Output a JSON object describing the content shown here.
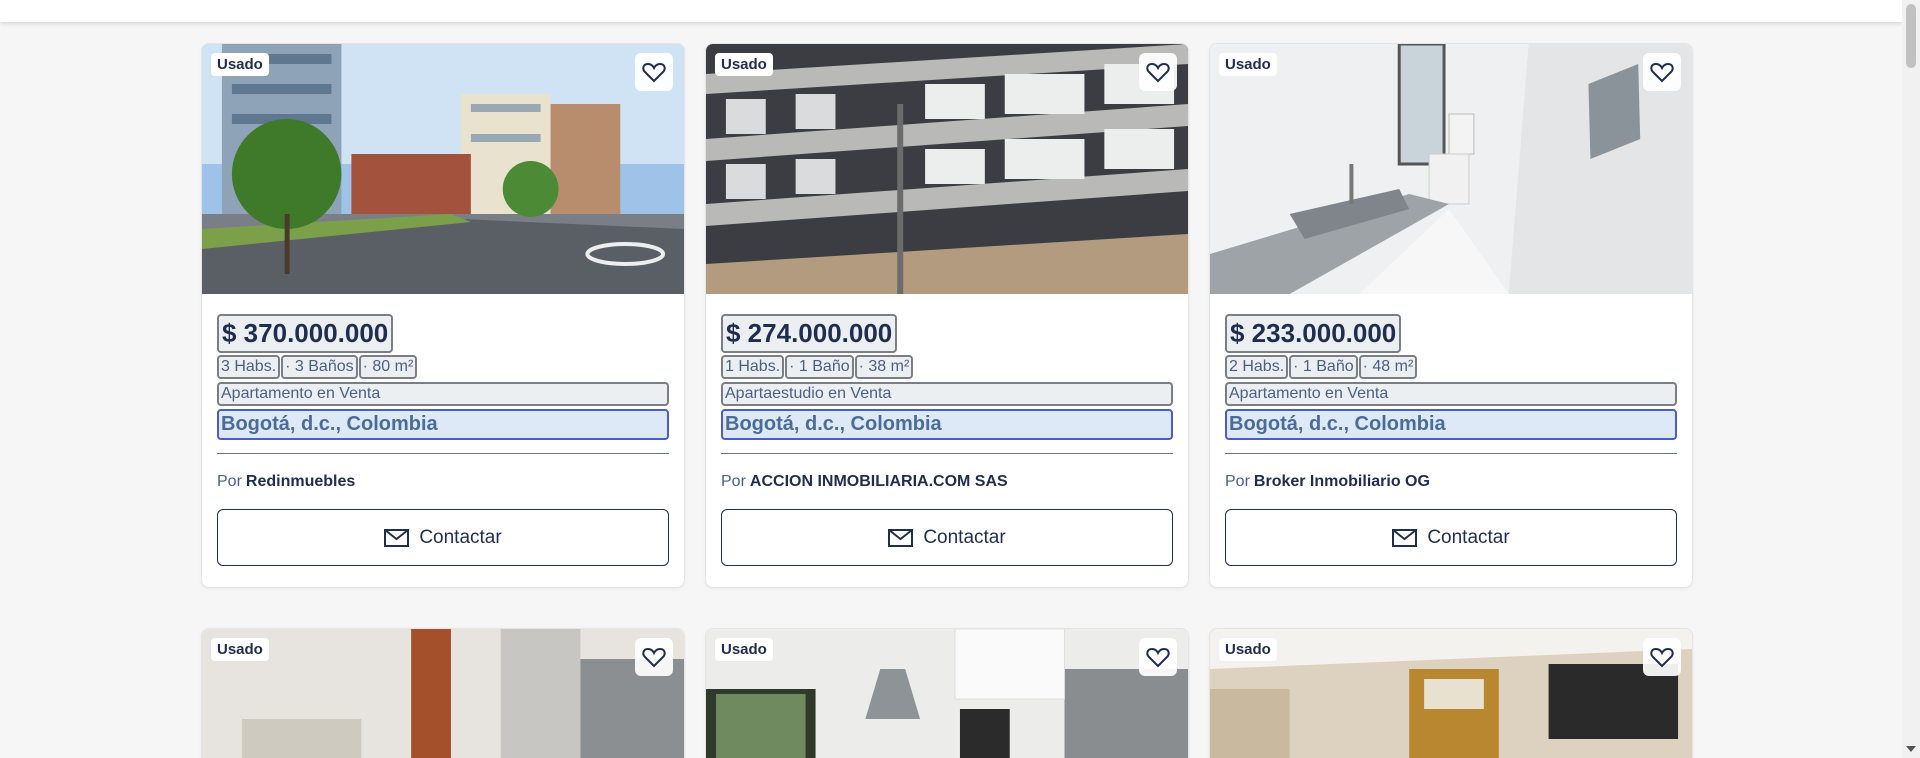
{
  "listings": [
    {
      "badge": "Usado",
      "price": "$ 370.000.000",
      "features": [
        "3 Habs.",
        "· 3 Baños",
        "· 80 m²"
      ],
      "type": "Apartamento en Venta",
      "location": "Bogotá, d.c., Colombia",
      "by_label": "Por",
      "agency": "Redinmuebles",
      "contact_label": "Contactar"
    },
    {
      "badge": "Usado",
      "price": "$ 274.000.000",
      "features": [
        "1 Habs.",
        "· 1 Baño",
        "· 38 m²"
      ],
      "type": "Apartaestudio en Venta",
      "location": "Bogotá, d.c., Colombia",
      "by_label": "Por",
      "agency": "ACCION INMOBILIARIA.COM SAS",
      "contact_label": "Contactar"
    },
    {
      "badge": "Usado",
      "price": "$ 233.000.000",
      "features": [
        "2 Habs.",
        "· 1 Baño",
        "· 48 m²"
      ],
      "type": "Apartamento en Venta",
      "location": "Bogotá, d.c., Colombia",
      "by_label": "Por",
      "agency": "Broker Inmobiliario OG",
      "contact_label": "Contactar"
    },
    {
      "badge": "Usado"
    },
    {
      "badge": "Usado"
    },
    {
      "badge": "Usado"
    }
  ],
  "icons": {
    "favorite": "heart-icon",
    "contact": "envelope-icon"
  },
  "colors": {
    "primary": "#1f2d4e",
    "location_bg": "#dde9f7",
    "location_border": "#4b5bd0"
  }
}
